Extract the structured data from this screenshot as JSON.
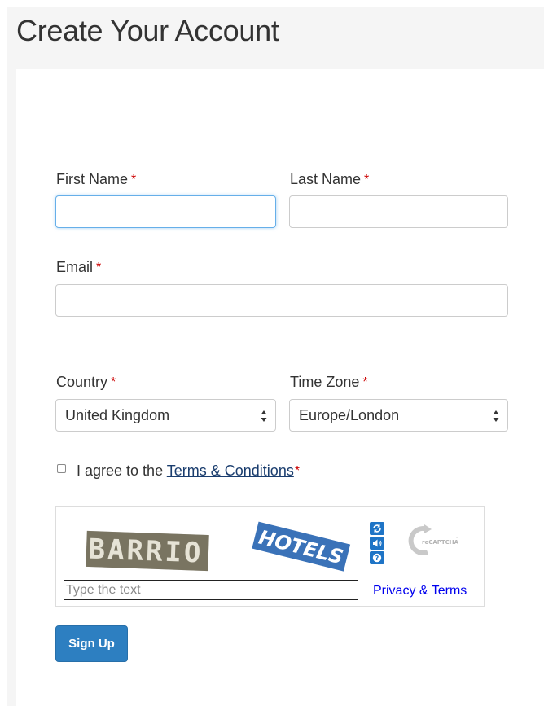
{
  "page": {
    "title": "Create Your Account"
  },
  "form": {
    "first_name": {
      "label": "First Name",
      "required_mark": "*",
      "value": ""
    },
    "last_name": {
      "label": "Last Name",
      "required_mark": "*",
      "value": ""
    },
    "email": {
      "label": "Email",
      "required_mark": "*",
      "value": ""
    },
    "country": {
      "label": "Country",
      "required_mark": "*",
      "value": "United Kingdom"
    },
    "time_zone": {
      "label": "Time Zone",
      "required_mark": "*",
      "value": "Europe/London"
    },
    "agree": {
      "prefix": "I agree to the ",
      "link_text": "Terms & Conditions",
      "required_mark": "*",
      "checked": false
    },
    "captcha": {
      "word1": "BARRIO",
      "word2": "HOTELS",
      "placeholder": "Type the text",
      "privacy_link": "Privacy & Terms",
      "logo_text": "reCAPTCHA",
      "logo_tm": "™",
      "refresh_icon": "refresh-icon",
      "audio_icon": "audio-icon",
      "help_icon": "help-icon"
    },
    "submit_label": "Sign Up"
  },
  "colors": {
    "required": "#cc0000",
    "primary_button": "#2d7fc1",
    "link": "#1a3d6e",
    "captcha_button": "#1e74c6",
    "focus_border": "#66afe9"
  }
}
